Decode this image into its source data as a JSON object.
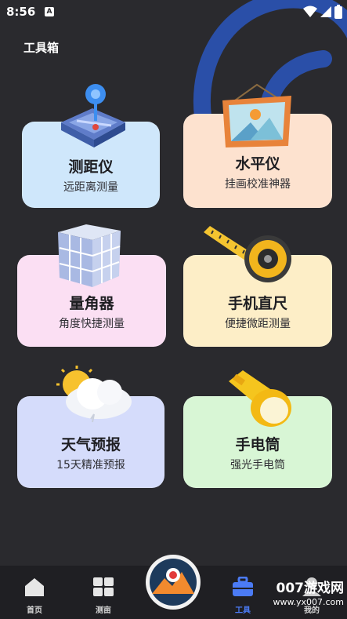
{
  "status": {
    "time": "8:56",
    "badge": "A"
  },
  "page": {
    "title": "工具箱"
  },
  "cards": [
    {
      "name": "测距仪",
      "sub": "远距离测量",
      "bg": "#cfe7fb"
    },
    {
      "name": "水平仪",
      "sub": "挂画校准神器",
      "bg": "#fde2cf"
    },
    {
      "name": "量角器",
      "sub": "角度快捷测量",
      "bg": "#fbdff3"
    },
    {
      "name": "手机直尺",
      "sub": "便捷微距测量",
      "bg": "#fdeec7"
    },
    {
      "name": "天气预报",
      "sub": "15天精准预报",
      "bg": "#d5dcfb"
    },
    {
      "name": "手电筒",
      "sub": "强光手电筒",
      "bg": "#d8f6d5"
    }
  ],
  "nav": {
    "items": [
      {
        "label": "首页",
        "icon": "home-icon"
      },
      {
        "label": "测亩",
        "icon": "grid-icon"
      },
      {
        "label": "工具",
        "icon": "toolbox-icon",
        "active": true
      },
      {
        "label": "我的",
        "icon": "user-icon"
      }
    ],
    "active_color": "#4b7bf5"
  },
  "watermark": {
    "line1": "007游戏网",
    "line2": "www.yx007.com"
  }
}
